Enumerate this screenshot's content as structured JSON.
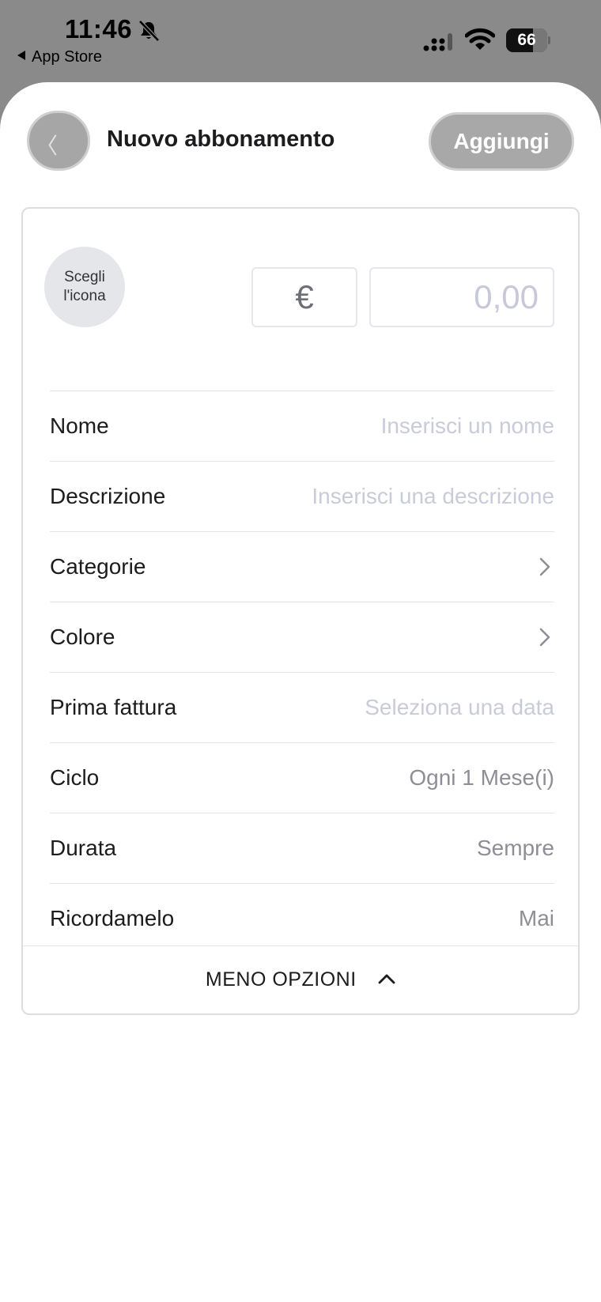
{
  "status_bar": {
    "time": "11:46",
    "back_app_label": "App Store",
    "battery_level": "66",
    "battery_fraction": 0.66
  },
  "nav": {
    "title": "Nuovo abbonamento",
    "add_label": "Aggiungi"
  },
  "form": {
    "icon_picker_label": "Scegli l'icona",
    "currency_symbol": "€",
    "amount_placeholder": "0,00",
    "rows": [
      {
        "label": "Nome",
        "value": "Inserisci un nome",
        "kind": "placeholder"
      },
      {
        "label": "Descrizione",
        "value": "Inserisci una descrizione",
        "kind": "placeholder"
      },
      {
        "label": "Categorie",
        "value": "",
        "kind": "chevron"
      },
      {
        "label": "Colore",
        "value": "",
        "kind": "chevron"
      },
      {
        "label": "Prima fattura",
        "value": "Seleziona una data",
        "kind": "placeholder"
      },
      {
        "label": "Ciclo",
        "value": "Ogni 1 Mese(i)",
        "kind": "value"
      },
      {
        "label": "Durata",
        "value": "Sempre",
        "kind": "value"
      },
      {
        "label": "Ricordamelo",
        "value": "Mai",
        "kind": "value"
      }
    ],
    "less_options_label": "MENO OPZIONI"
  },
  "colors": {
    "label": "#1c1c1e",
    "placeholder": "#c9cbd9",
    "muted_value": "#8e8e96",
    "disabled_button": "#a8a8a8"
  }
}
